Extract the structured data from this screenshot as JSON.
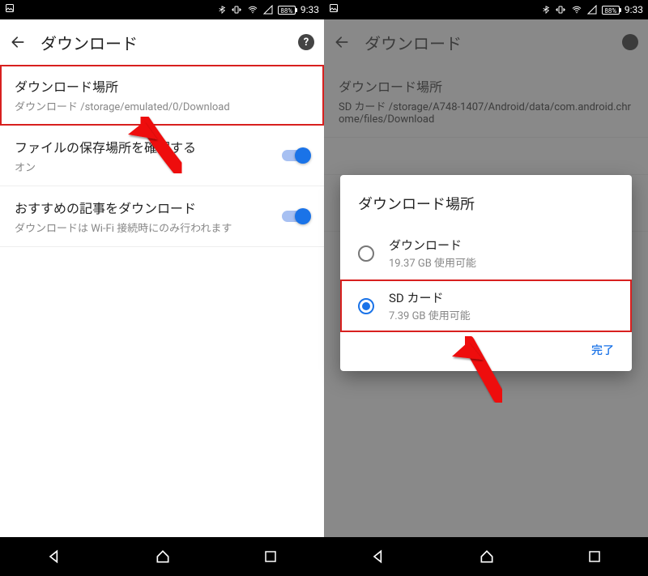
{
  "status": {
    "battery_pct": "88%",
    "time": "9:33"
  },
  "left": {
    "title": "ダウンロード",
    "rows": {
      "location": {
        "title": "ダウンロード場所",
        "sub_prefix": "ダウンロード ",
        "sub_path": "/storage/emulated/0/Download"
      },
      "confirm": {
        "title": "ファイルの保存場所を確認する",
        "sub": "オン"
      },
      "recommend": {
        "title": "おすすめの記事をダウンロード",
        "sub": "ダウンロードは Wi-Fi 接続時にのみ行われます"
      }
    }
  },
  "right": {
    "title": "ダウンロード",
    "rows": {
      "location": {
        "title": "ダウンロード場所",
        "sub_prefix": "SD カード ",
        "sub_path": "/storage/A748-1407/Android/data/com.android.chrome/files/Download"
      }
    },
    "dialog": {
      "title": "ダウンロード場所",
      "opt1": {
        "title": "ダウンロード",
        "sub": "19.37 GB 使用可能"
      },
      "opt2": {
        "title": "SD カード",
        "sub": "7.39 GB 使用可能"
      },
      "done": "完了"
    }
  }
}
